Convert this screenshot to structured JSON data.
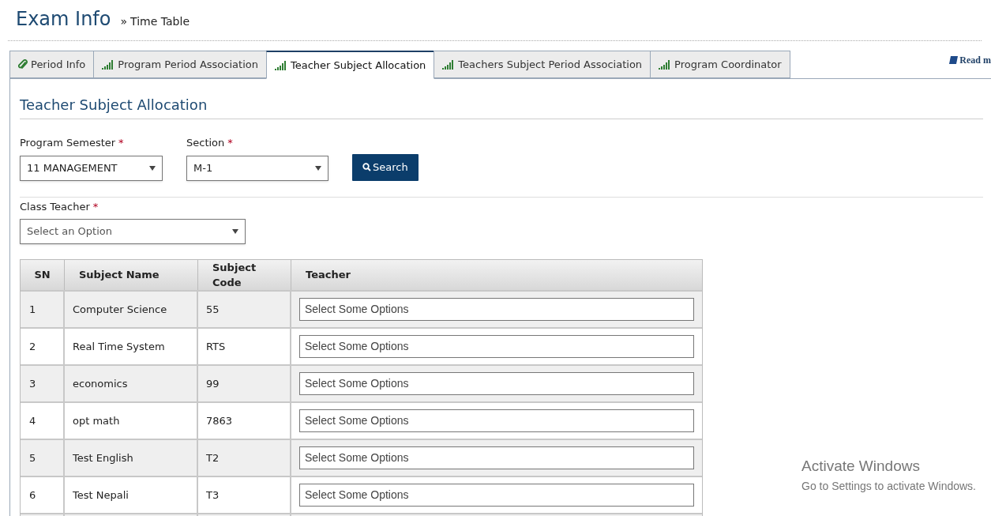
{
  "header": {
    "title": "Exam Info",
    "breadcrumb_separator": "»",
    "breadcrumb": "Time Table"
  },
  "tabs": [
    {
      "label": "Period Info",
      "kind": "clip",
      "selected": false
    },
    {
      "label": "Program Period Association",
      "kind": "bars",
      "selected": false
    },
    {
      "label": "Teacher Subject Allocation",
      "kind": "bars",
      "selected": true
    },
    {
      "label": "Teachers Subject Period Association",
      "kind": "bars",
      "selected": false
    },
    {
      "label": "Program Coordinator",
      "kind": "bars",
      "selected": false
    }
  ],
  "read_link": "Read m",
  "panel": {
    "title": "Teacher Subject Allocation",
    "filters": [
      {
        "label": "Program Semester",
        "required_mark": "*",
        "value": "11 MANAGEMENT"
      },
      {
        "label": "Section",
        "required_mark": "*",
        "value": "M-1"
      }
    ],
    "search_button": "Search",
    "class_teacher": {
      "label": "Class Teacher",
      "required_mark": "*",
      "value": "Select an Option"
    },
    "table": {
      "columns": [
        "SN",
        "Subject Name",
        "Subject Code",
        "Teacher"
      ],
      "rows": [
        {
          "sn": "1",
          "subject_name": "Computer Science",
          "subject_code": "55",
          "teacher_placeholder": "Select Some Options"
        },
        {
          "sn": "2",
          "subject_name": "Real Time System",
          "subject_code": "RTS",
          "teacher_placeholder": "Select Some Options"
        },
        {
          "sn": "3",
          "subject_name": "economics",
          "subject_code": "99",
          "teacher_placeholder": "Select Some Options"
        },
        {
          "sn": "4",
          "subject_name": "opt math",
          "subject_code": "7863",
          "teacher_placeholder": "Select Some Options"
        },
        {
          "sn": "5",
          "subject_name": "Test English",
          "subject_code": "T2",
          "teacher_placeholder": "Select Some Options"
        },
        {
          "sn": "6",
          "subject_name": "Test Nepali",
          "subject_code": "T3",
          "teacher_placeholder": "Select Some Options"
        }
      ]
    }
  },
  "os_notice": {
    "title": "Activate Windows",
    "text": "Go to Settings to activate Windows."
  }
}
